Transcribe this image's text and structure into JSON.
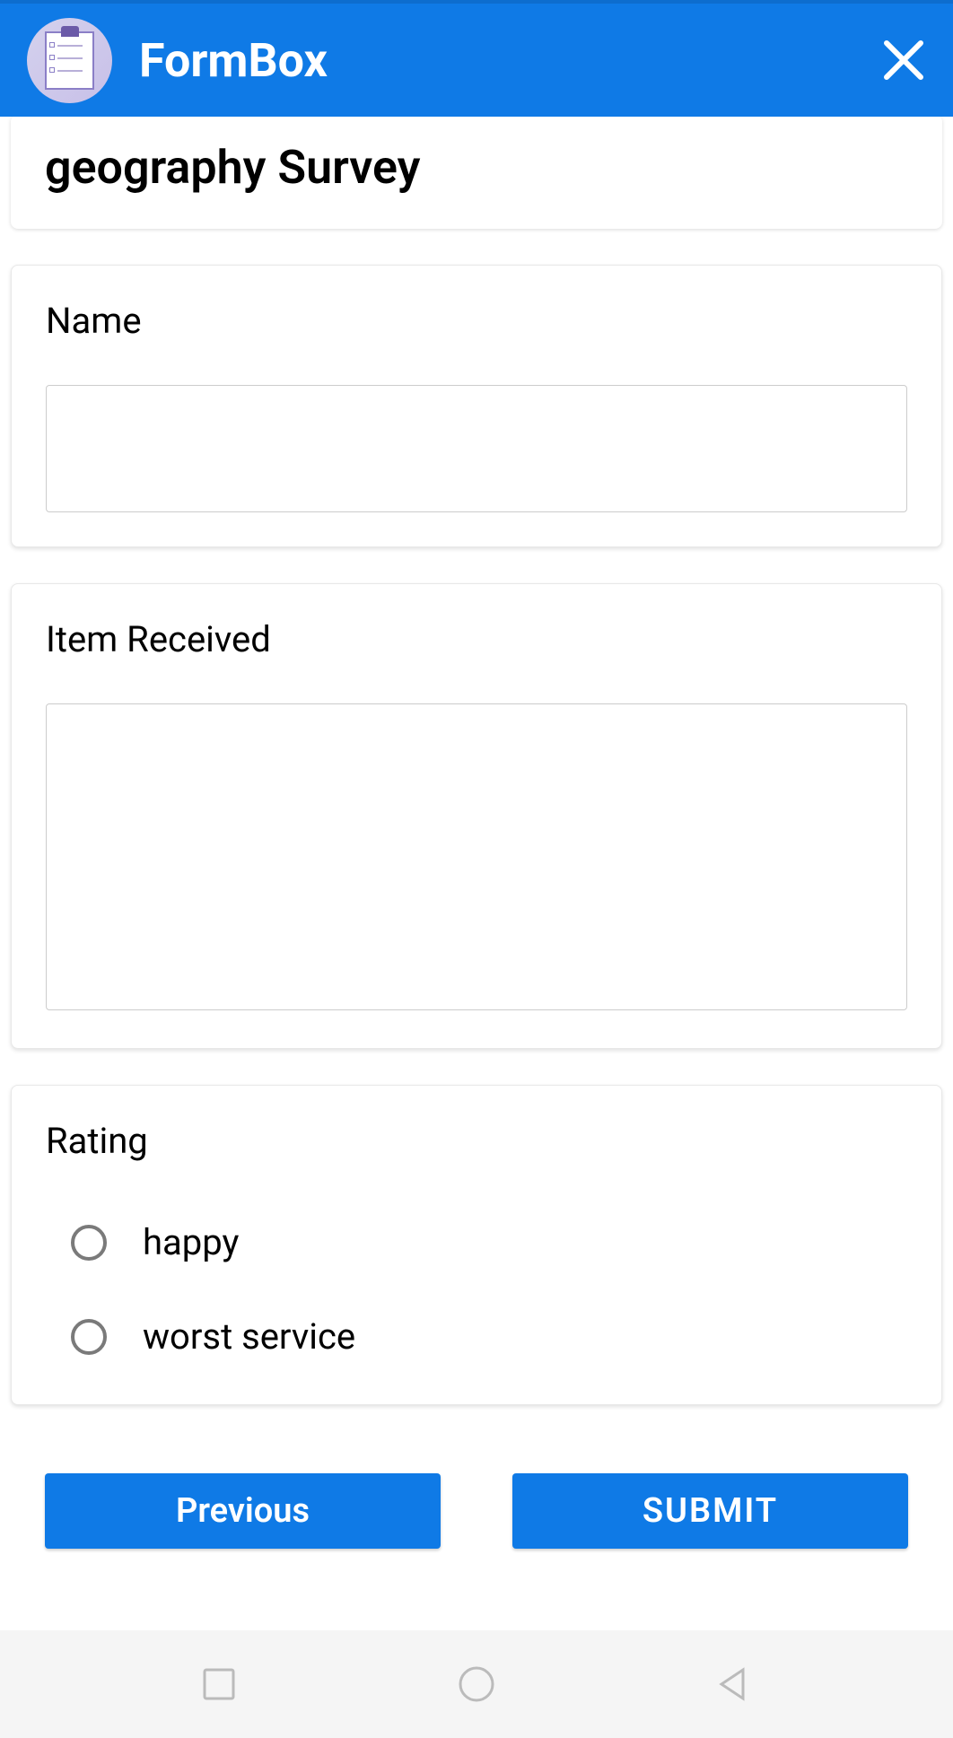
{
  "header": {
    "app_title": "FormBox"
  },
  "form": {
    "title": "geography Survey",
    "questions": [
      {
        "label": "Name",
        "type": "text",
        "value": ""
      },
      {
        "label": "Item Received",
        "type": "textarea",
        "value": ""
      },
      {
        "label": "Rating",
        "type": "radio",
        "options": [
          "happy",
          "worst service"
        ]
      }
    ]
  },
  "buttons": {
    "previous": "Previous",
    "submit": "SUBMIT"
  }
}
